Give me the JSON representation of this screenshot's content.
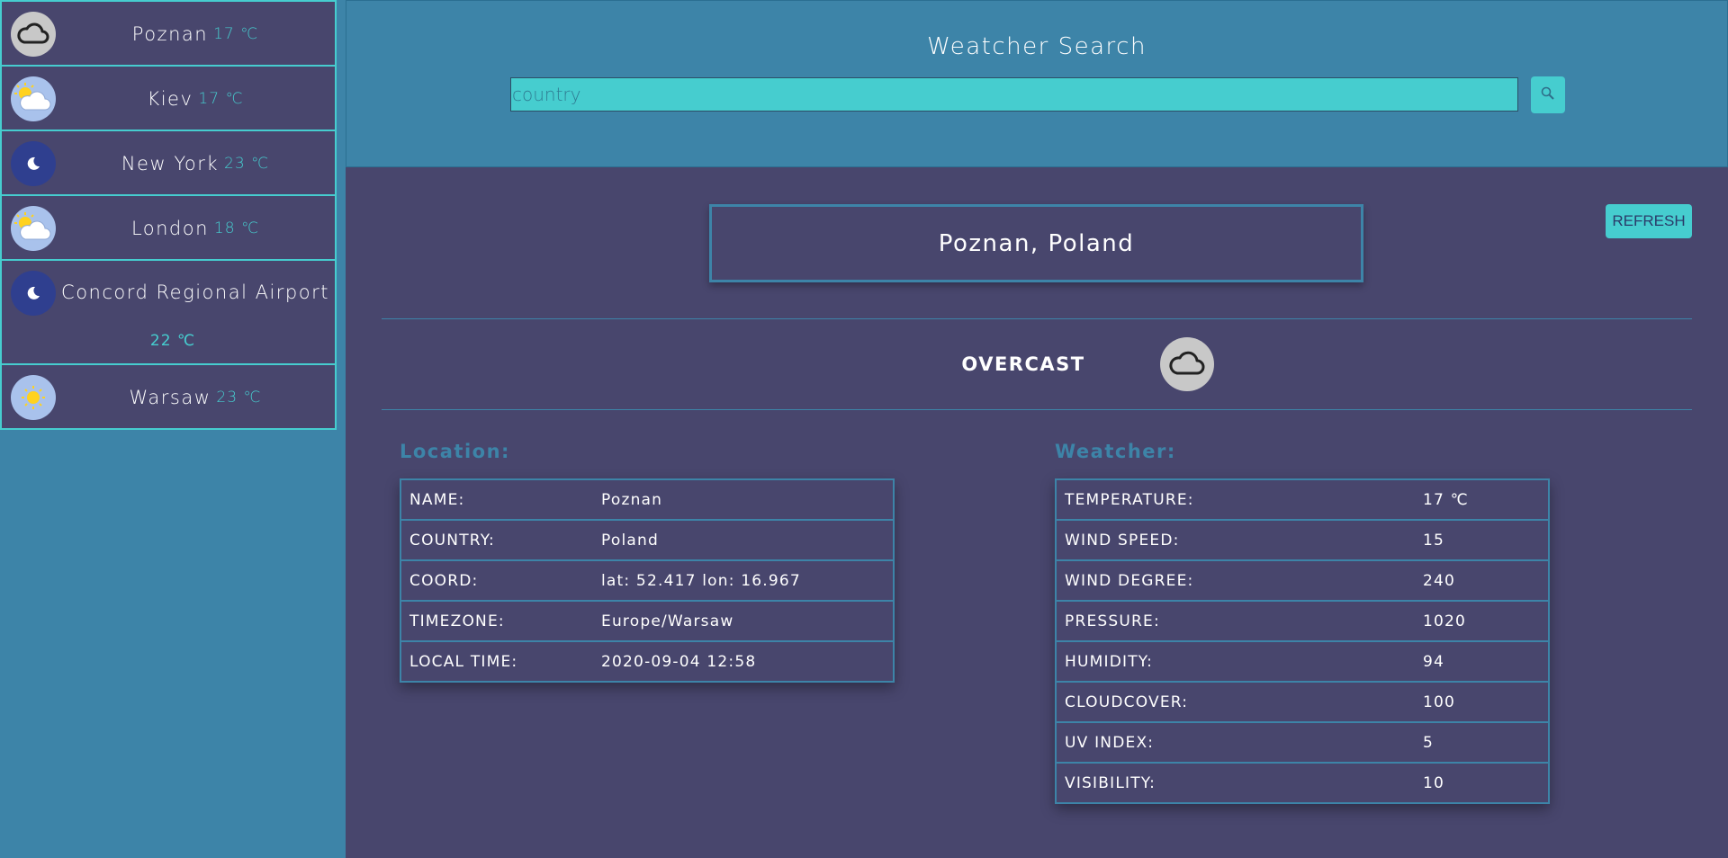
{
  "sidebar": {
    "cities": [
      {
        "name": "Poznan",
        "temp": "17 ℃",
        "icon": "cloud-icon"
      },
      {
        "name": "Kiev",
        "temp": "17 ℃",
        "icon": "partly-cloudy-icon"
      },
      {
        "name": "New York",
        "temp": "23 ℃",
        "icon": "moon-icon"
      },
      {
        "name": "London",
        "temp": "18 ℃",
        "icon": "partly-cloudy-icon"
      },
      {
        "name": "Concord Regional Airport",
        "temp": "22 ℃",
        "icon": "moon-icon"
      },
      {
        "name": "Warsaw",
        "temp": "23 ℃",
        "icon": "sun-icon"
      }
    ]
  },
  "header": {
    "title": "Weatcher Search",
    "search_placeholder": "country",
    "search_icon": "search-icon"
  },
  "main": {
    "place": "Poznan, Poland",
    "refresh_label": "REFRESH",
    "condition": "OVERCAST",
    "condition_icon": "cloud-icon",
    "location": {
      "title": "Location:",
      "rows": [
        {
          "key": "NAME:",
          "value": "Poznan"
        },
        {
          "key": "COUNTRY:",
          "value": "Poland"
        },
        {
          "key": "COORD:",
          "value": "lat: 52.417 lon: 16.967"
        },
        {
          "key": "TIMEZONE:",
          "value": "Europe/Warsaw"
        },
        {
          "key": "LOCAL TIME:",
          "value": "2020-09-04 12:58"
        }
      ]
    },
    "weather": {
      "title": "Weatcher:",
      "rows": [
        {
          "key": "TEMPERATURE:",
          "value": "17 ℃"
        },
        {
          "key": "WIND SPEED:",
          "value": "15"
        },
        {
          "key": "WIND DEGREE:",
          "value": "240"
        },
        {
          "key": "PRESSURE:",
          "value": "1020"
        },
        {
          "key": "HUMIDITY:",
          "value": "94"
        },
        {
          "key": "CLOUDCOVER:",
          "value": "100"
        },
        {
          "key": "UV INDEX:",
          "value": "5"
        },
        {
          "key": "VISIBILITY:",
          "value": "10"
        }
      ]
    }
  },
  "colors": {
    "panel": "#48466d",
    "accent": "#46cdcf",
    "blue": "#3d84a8"
  }
}
